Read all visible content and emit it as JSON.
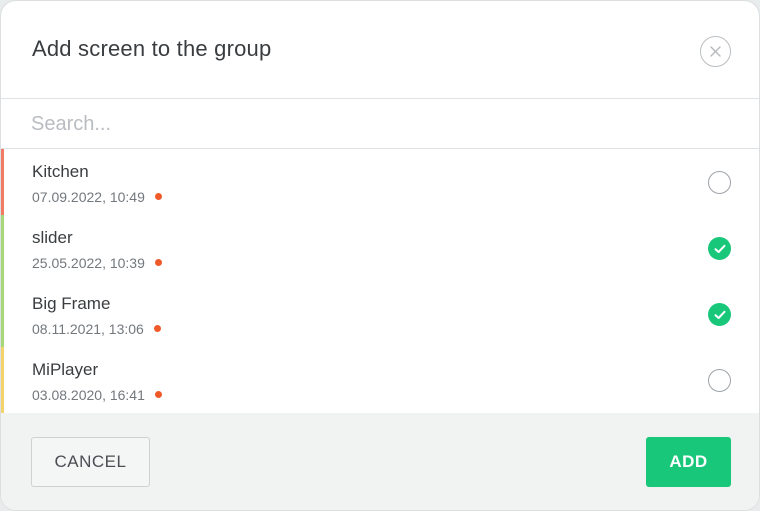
{
  "dialog": {
    "title": "Add screen to the group",
    "close_icon": "close-icon"
  },
  "search": {
    "placeholder": "Search...",
    "value": ""
  },
  "screens": [
    {
      "name": "Kitchen",
      "date": "07.09.2022, 10:49",
      "selected": false,
      "accent": "#f07b62",
      "status_color": "#f05a2a"
    },
    {
      "name": "slider",
      "date": "25.05.2022, 10:39",
      "selected": true,
      "accent": "#a6d87a",
      "status_color": "#f05a2a"
    },
    {
      "name": "Big Frame",
      "date": "08.11.2021, 13:06",
      "selected": true,
      "accent": "#a6d87a",
      "status_color": "#f05a2a"
    },
    {
      "name": "MiPlayer",
      "date": "03.08.2020, 16:41",
      "selected": false,
      "accent": "#f2d36c",
      "status_color": "#f05a2a"
    }
  ],
  "footer": {
    "cancel_label": "CANCEL",
    "add_label": "ADD"
  },
  "colors": {
    "primary": "#19c77a",
    "check_on": "#19c77a"
  }
}
